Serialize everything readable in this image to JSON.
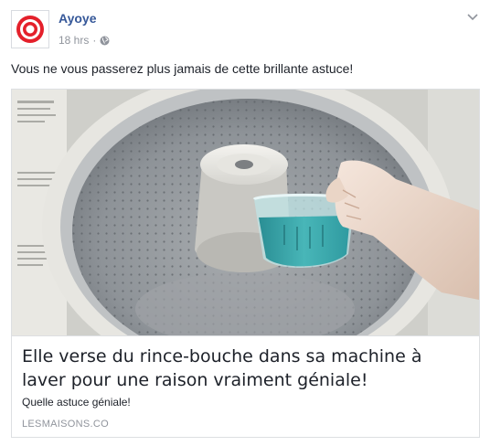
{
  "post": {
    "page_name": "Ayoye",
    "time": "18 hrs",
    "separator": "·",
    "audience_icon": "globe-icon",
    "menu_icon": "chevron-down-icon",
    "message": "Vous ne vous passerez plus jamais de cette brillante astuce!"
  },
  "link_card": {
    "image_icon": "washing-machine-photo",
    "title": "Elle verse du rince-bouche dans sa machine à laver pour une raison vraiment géniale!",
    "description": "Quelle astuce géniale!",
    "domain": "LESMAISONS.CO"
  },
  "colors": {
    "page_name": "#365899",
    "meta": "#90949c",
    "text": "#1d2129",
    "avatar_red": "#e4202b",
    "border": "#dddfe2"
  }
}
